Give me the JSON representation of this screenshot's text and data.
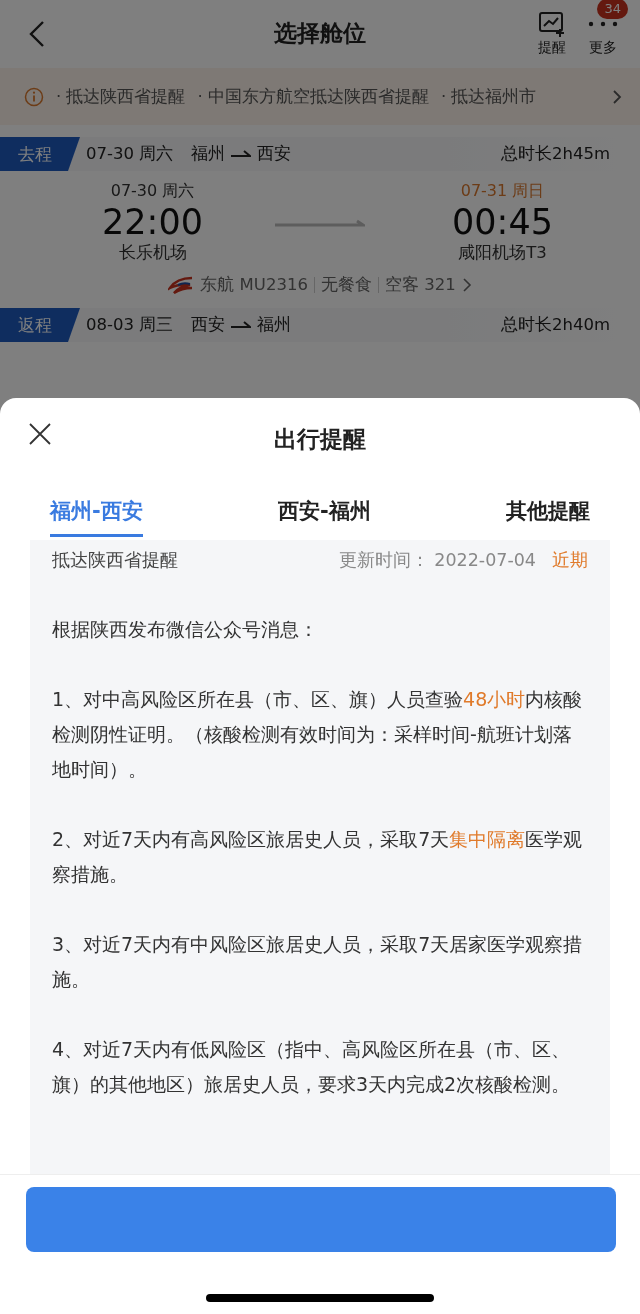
{
  "header": {
    "title": "选择舱位",
    "actions": [
      {
        "label": "提醒"
      },
      {
        "label": "更多",
        "badge": "34"
      }
    ]
  },
  "notices": [
    "· 抵达陕西省提醒",
    "· 中国东方航空抵达陕西省提醒",
    "· 抵达福州市"
  ],
  "segments": [
    {
      "tag": "去程",
      "date": "07-30 周六",
      "from": "福州",
      "to": "西安",
      "duration": "总时长2h45m",
      "detail": {
        "depart_date": "07-30 周六",
        "depart_time": "22:00",
        "depart_airport": "长乐机场",
        "arrive_date": "07-31 周日",
        "arrive_next_day": true,
        "arrive_time": "00:45",
        "arrive_airport": "咸阳机场T3",
        "flight": [
          "东航 MU2316",
          "无餐食",
          "空客 321"
        ]
      }
    },
    {
      "tag": "返程",
      "date": "08-03 周三",
      "from": "西安",
      "to": "福州",
      "duration": "总时长2h40m"
    }
  ],
  "sheet": {
    "title": "出行提醒",
    "tabs": [
      {
        "label": "福州-西安",
        "selected": true
      },
      {
        "label": "西安-福州",
        "selected": false
      },
      {
        "label": "其他提醒",
        "selected": false
      }
    ],
    "notice": {
      "title": "抵达陕西省提醒",
      "updated": "更新时间：  2022-07-04",
      "tag": "近期"
    },
    "paragraphs": [
      [
        {
          "text": "根据陕西发布微信公众号消息："
        }
      ],
      [
        {
          "text": "1、对中高风险区所在县（市、区、旗）人员查验"
        },
        {
          "text": "48小时",
          "highlight": true
        },
        {
          "text": "内核酸检测阴性证明。（核酸检测有效时间为：采样时间-航班计划落地时间）。"
        }
      ],
      [
        {
          "text": "2、对近7天内有高风险区旅居史人员，采取7天"
        },
        {
          "text": "集中隔离",
          "highlight": true
        },
        {
          "text": "医学观察措施。"
        }
      ],
      [
        {
          "text": "3、对近7天内有中风险区旅居史人员，采取7天居家医学观察措施。"
        }
      ],
      [
        {
          "text": "4、对近7天内有低风险区（指中、高风险区所在县（市、区、旗）的其他地区）旅居史人员，要求3天内完成2次核酸检测。"
        }
      ]
    ]
  }
}
